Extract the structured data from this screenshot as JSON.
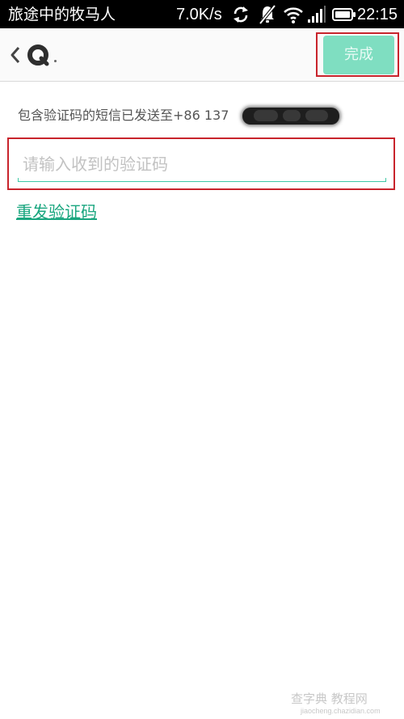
{
  "status_bar": {
    "title": "旅途中的牧马人",
    "net_speed": "7.0K/s",
    "time": "22:15",
    "icons": [
      "sync-icon",
      "muted-bell-icon",
      "wifi-icon",
      "signal-icon",
      "battery-icon"
    ]
  },
  "action_bar": {
    "back_icon": "chevron-left-icon",
    "logo_icon": "app-logo-icon",
    "done_label": "完成"
  },
  "content": {
    "info_text": "包含验证码的短信已发送至+86 137",
    "code_input": {
      "placeholder": "请输入收到的验证码",
      "value": ""
    },
    "resend_label": "重发验证码"
  },
  "watermark": {
    "main": "查字典 教程网",
    "sub": "jiaocheng.chazidian.com"
  },
  "colors": {
    "accent": "#3fc8a5",
    "link": "#1aa67f",
    "done_button_bg": "#7fdec1",
    "highlight_frame": "#c8242c",
    "status_bar_bg": "#000000"
  }
}
